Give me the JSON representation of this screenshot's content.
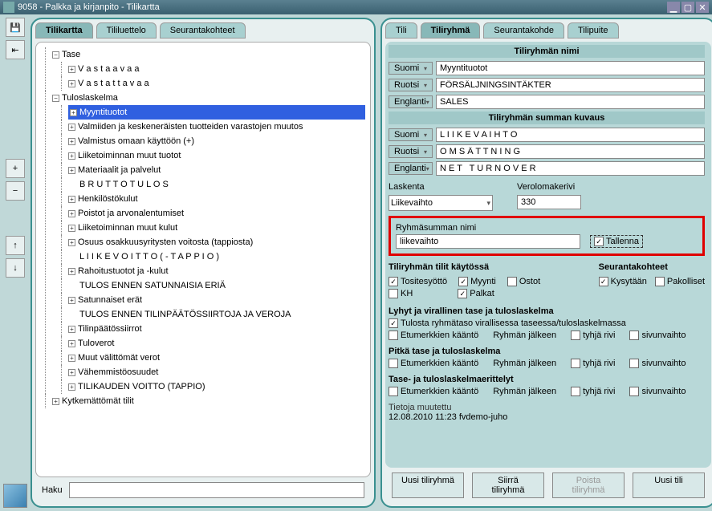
{
  "window": {
    "title": "9058 - Palkka ja kirjanpito - Tilikartta"
  },
  "leftTabs": [
    "Tilikartta",
    "Tililuettelo",
    "Seurantakohteet"
  ],
  "leftActive": 0,
  "rightTabs": [
    "Tili",
    "Tiliryhmä",
    "Seurantakohde",
    "Tilipuite"
  ],
  "rightActive": 1,
  "tree": {
    "root": "Tase",
    "vastaavaa": "V a s t a a v a a",
    "vastattavaa": "V a s t a t t a v a a",
    "tuloslaskelma": "Tuloslaskelma",
    "items": [
      "Myyntituotot",
      "Valmiiden ja keskeneräisten tuotteiden varastojen muutos",
      "Valmistus omaan käyttöön (+)",
      "Liiketoiminnan muut tuotot",
      "Materiaalit ja palvelut",
      "B R U T T O T U L O S",
      "Henkilöstökulut",
      "Poistot ja arvonalentumiset",
      "Liiketoiminnan muut kulut",
      "Osuus osakkuusyritysten voitosta (tappiosta)",
      "L I I K E V O I T T O   ( - T A P P I O )",
      "Rahoitustuotot ja -kulut",
      "TULOS ENNEN SATUNNAISIA ERIÄ",
      "Satunnaiset erät",
      "TULOS ENNEN TILINPÄÄTÖSSIIRTOJA  JA VEROJA",
      "Tilinpäätössiirrot",
      "Tuloverot",
      "Muut välittömät verot",
      "Vähemmistöosuudet",
      "TILIKAUDEN VOITTO (TAPPIO)"
    ],
    "kytkemattomat": "Kytkemättömät tilit"
  },
  "searchLabel": "Haku",
  "form": {
    "section1": "Tiliryhmän nimi",
    "section2": "Tiliryhmän summan kuvaus",
    "lang": {
      "fi": "Suomi",
      "sv": "Ruotsi",
      "en": "Englanti"
    },
    "name": {
      "fi": "Myyntituotot",
      "sv": "FÖRSÄLJNINGSINTÄKTER",
      "en": "SALES"
    },
    "sum": {
      "fi": "L I I K E V A I H T O",
      "sv": "O M S Ä T T N I N G",
      "en": "N E T   T U R N O V E R"
    },
    "laskentaLabel": "Laskenta",
    "laskentaValue": "Liikevaihto",
    "verolomakeLabel": "Verolomakerivi",
    "verolomakeValue": "330",
    "ryhmaLabel": "Ryhmäsumman nimi",
    "ryhmaValue": "liikevaihto",
    "tallenna": "Tallenna",
    "tilitTitle": "Tiliryhmän tilit käytössä",
    "seurantaTitle": "Seurantakohteet",
    "chk": {
      "tositesyotto": "Tositesyöttö",
      "myynti": "Myynti",
      "ostot": "Ostot",
      "kh": "KH",
      "palkat": "Palkat",
      "kysytaan": "Kysytään",
      "pakolliset": "Pakolliset"
    },
    "g1": "Lyhyt ja virallinen tase ja tuloslaskelma",
    "g1a": "Tulosta ryhmätaso virallisessa taseessa/tuloslaskelmassa",
    "g2": "Pitkä tase ja tuloslaskelma",
    "g3": "Tase- ja tuloslaskelmaerittelyt",
    "opts": {
      "etumerkki": "Etumerkkien kääntö",
      "ryhman": "Ryhmän jälkeen",
      "tyhja": "tyhjä rivi",
      "sivun": "sivunvaihto"
    },
    "muutettuLabel": "Tietoja muutettu",
    "muutettuValue": "12.08.2010 11:23  fvdemo-juho"
  },
  "buttons": {
    "uusiTiliryhma": "Uusi tiliryhmä",
    "siirra": "Siirrä tiliryhmä",
    "poista": "Poista tiliryhmä",
    "uusiTili": "Uusi tili"
  }
}
